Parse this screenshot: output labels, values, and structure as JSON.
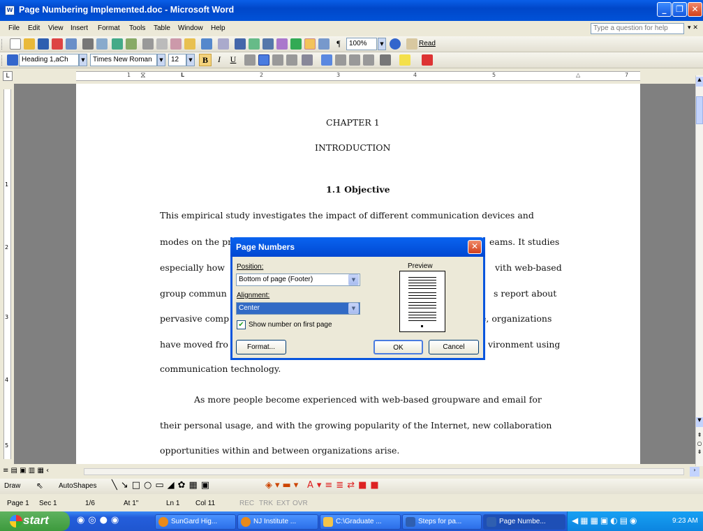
{
  "window": {
    "title": "Page Numbering Implemented.doc - Microsoft Word"
  },
  "menu": {
    "items": [
      "File",
      "Edit",
      "View",
      "Insert",
      "Format",
      "Tools",
      "Table",
      "Window",
      "Help"
    ],
    "help_placeholder": "Type a question for help"
  },
  "toolbar": {
    "zoom": "100%",
    "read_label": "Read",
    "style": "Heading 1,aCh",
    "font": "Times New Roman",
    "size": "12",
    "bold": "B",
    "italic": "I",
    "underline": "U"
  },
  "ruler": {
    "h_marks": [
      "1",
      "2",
      "3",
      "4",
      "5",
      "7"
    ],
    "v_marks": [
      "1",
      "2",
      "3",
      "4",
      "5"
    ]
  },
  "document": {
    "chapter": "CHAPTER 1",
    "heading": "INTRODUCTION",
    "subheading": "1.1  Objective",
    "lines": [
      "This empirical study investigates the impact of different communication devices and",
      "modes on the pr",
      "especially how",
      "group commun",
      "pervasive comp",
      "have moved fro",
      "communication technology."
    ],
    "right_fragments": [
      "eams. It studies",
      "vith web-based",
      "s report about",
      "e, organizations",
      "vironment using"
    ],
    "para2": [
      "As more people become experienced with web-based groupware and email for",
      "their personal usage, and with the growing popularity of the Internet, new collaboration",
      "opportunities within and between organizations arise."
    ]
  },
  "dialog": {
    "title": "Page Numbers",
    "position_label": "Position:",
    "position_value": "Bottom of page (Footer)",
    "alignment_label": "Alignment:",
    "alignment_value": "Center",
    "checkbox_label": "Show number on first page",
    "checkbox_checked": true,
    "preview_label": "Preview",
    "format_button": "Format...",
    "ok_button": "OK",
    "cancel_button": "Cancel"
  },
  "drawbar": {
    "draw": "Draw",
    "autoshapes": "AutoShapes"
  },
  "status": {
    "page": "Page 1",
    "sec": "Sec 1",
    "pages": "1/6",
    "at": "At 1\"",
    "ln": "Ln 1",
    "col": "Col 11",
    "rec": "REC",
    "trk": "TRK",
    "ext": "EXT",
    "ovr": "OVR"
  },
  "taskbar": {
    "start": "start",
    "tasks": [
      "SunGard Hig...",
      "NJ Institute ...",
      "C:\\Graduate ...",
      "Steps for pa...",
      "Page Numbe..."
    ],
    "clock": "9:23 AM"
  },
  "colors": {
    "title_blue": "#0a64f0",
    "taskbar_blue": "#245edb",
    "start_green": "#3d9a3d",
    "highlight": "#316ac5"
  }
}
